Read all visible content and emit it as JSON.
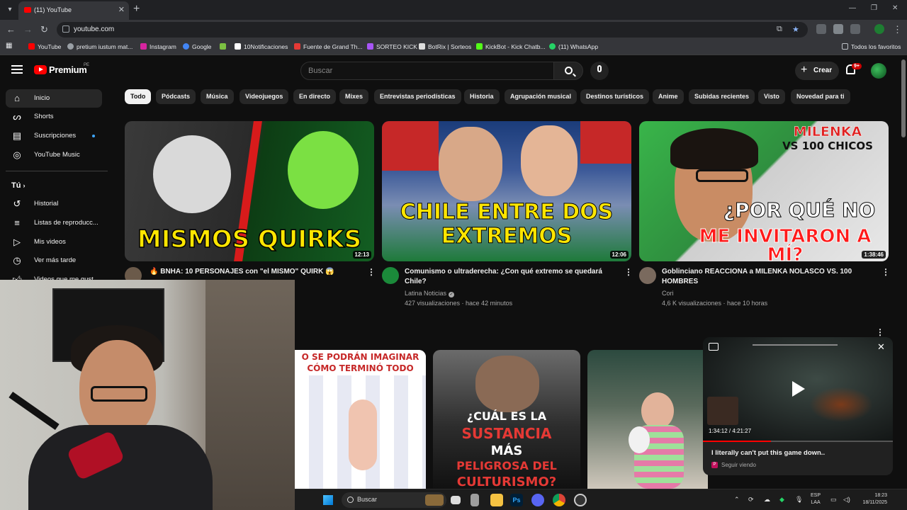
{
  "browser": {
    "tab_title": "(11) YouTube",
    "url": "youtube.com",
    "bookmarks": [
      {
        "label": "YouTube",
        "color": "#ff0000"
      },
      {
        "label": "pretium iustum mat...",
        "color": "#9aa0a6"
      },
      {
        "label": "Instagram",
        "color": "#d6249f"
      },
      {
        "label": "Google",
        "color": "#4285f4"
      },
      {
        "label": "",
        "color": "#7cc142"
      },
      {
        "label": "10Notificaciones",
        "color": "#ffffff"
      },
      {
        "label": "Fuente de Grand Th...",
        "color": "#e53935"
      },
      {
        "label": "SORTEO KICK",
        "color": "#a855f7"
      },
      {
        "label": "BotRix | Sorteos",
        "color": "#dddddd"
      },
      {
        "label": "KickBot - Kick Chatb...",
        "color": "#53fc18"
      },
      {
        "label": "(11) WhatsApp",
        "color": "#25d366"
      }
    ],
    "all_bookmarks": "Todos los favoritos"
  },
  "masthead": {
    "logo_text": "Premium",
    "country": "PE",
    "search_placeholder": "Buscar",
    "create_label": "Crear",
    "notifications": "9+"
  },
  "sidebar": {
    "items": [
      {
        "label": "Inicio",
        "icon": "home-icon"
      },
      {
        "label": "Shorts",
        "icon": "shorts-icon"
      },
      {
        "label": "Suscripciones",
        "icon": "subscriptions-icon"
      },
      {
        "label": "YouTube Music",
        "icon": "music-icon"
      }
    ],
    "you_header": "Tú",
    "you_items": [
      {
        "label": "Historial",
        "icon": "history-icon"
      },
      {
        "label": "Listas de reproducc...",
        "icon": "playlists-icon"
      },
      {
        "label": "Mis videos",
        "icon": "my-videos-icon"
      },
      {
        "label": "Ver más tarde",
        "icon": "watch-later-icon"
      },
      {
        "label": "Videos que me gust...",
        "icon": "liked-icon"
      }
    ]
  },
  "chips": [
    "Todo",
    "Pódcasts",
    "Música",
    "Videojuegos",
    "En directo",
    "Mixes",
    "Entrevistas periodísticas",
    "Historia",
    "Agrupación musical",
    "Destinos turísticos",
    "Anime",
    "Subidas recientes",
    "Visto",
    "Novedad para ti"
  ],
  "videos": [
    {
      "thumb_text": "MISMOS QUIRKS",
      "duration": "12:13",
      "title": "🔥 BNHA: 10 PERSONAJES con \"el MISMO\" QUIRK 😱",
      "channel": "",
      "meta": ""
    },
    {
      "thumb_text_1": "CHILE ENTRE DOS",
      "thumb_text_2": "EXTREMOS",
      "duration": "12:06",
      "title_1": "Comunismo o ultraderecha: ¿Con qué extremo se quedará",
      "title_2": "Chile?",
      "channel": "Latina Noticias",
      "meta": "427 visualizaciones · hace 42 minutos"
    },
    {
      "thumb_text_1": "MILENKA",
      "thumb_text_2": "VS 100 CHICOS",
      "thumb_text_3": "¿POR QUÉ NO",
      "thumb_text_4": "ME INVITARON A MÍ?",
      "duration": "1:38:46",
      "title_1": "Goblinciano REACCIONA a MILENKA NOLASCO VS. 100",
      "title_2": "HOMBRES",
      "channel": "Cori",
      "meta": "4,6 K visualizaciones · hace 10 horas"
    }
  ],
  "row2": [
    {
      "thumb_text_1": "O SE PODRÁN IMAGINAR",
      "thumb_text_2": "CÓMO TERMINÓ TODO"
    },
    {
      "thumb_text_1": "¿CUÁL ES LA",
      "thumb_text_2": "SUSTANCIA",
      "thumb_text_3": "MÁS",
      "thumb_text_4": "PELIGROSA DEL",
      "thumb_text_5": "CULTURISMO?"
    },
    {}
  ],
  "miniplayer": {
    "time": "1:34:12 / 4:21:27",
    "progress": 0.36,
    "title": "I literally can't put this game down..",
    "status": "Seguir viendo"
  },
  "taskbar": {
    "search_label": "Buscar",
    "lang_1": "ESP",
    "lang_2": "LAA",
    "time": "18:23",
    "date": "18/11/2025"
  }
}
